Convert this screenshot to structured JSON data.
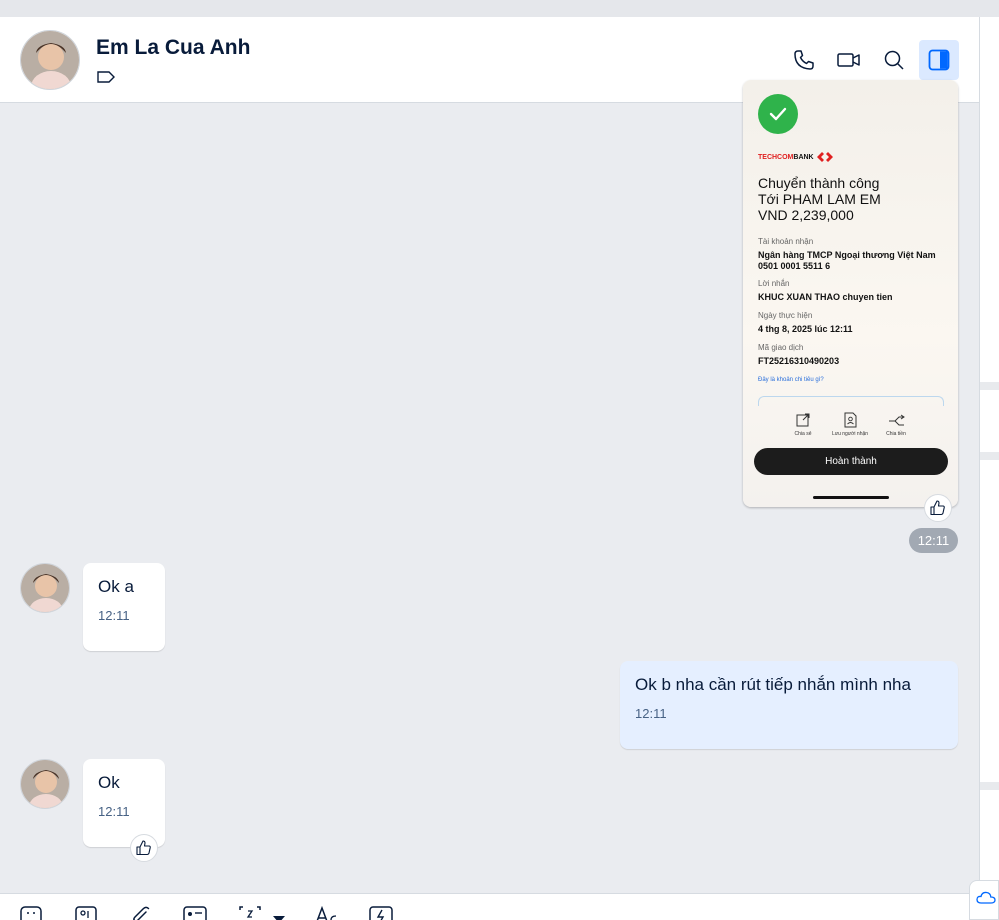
{
  "header": {
    "contact_name": "Em La Cua Anh"
  },
  "receipt": {
    "bank_brand": "TECHCOMBANK",
    "title_line1": "Chuyển thành công",
    "title_line2": "Tới PHAM LAM EM",
    "amount": "VND 2,239,000",
    "label_account": "Tài khoản nhận",
    "bank_name": "Ngân hàng TMCP Ngoại thương Việt Nam",
    "account_number": "0501 0001 5511 6",
    "label_message": "Lời nhắn",
    "message": "KHUC XUAN THAO chuyen tien",
    "label_date": "Ngày thực hiện",
    "date": "4 thg 8, 2025 lúc 12:11",
    "label_txn": "Mã giao dịch",
    "txn_id": "FT25216310490203",
    "question_link": "Đây là khoản chi tiêu gì?",
    "action_share": "Chia sẻ",
    "action_save": "Lưu người nhận",
    "action_split": "Chia tiền",
    "done_button": "Hoàn thành"
  },
  "image_time": "12:11",
  "messages": [
    {
      "text": "Ok a",
      "time": "12:11"
    },
    {
      "text": "Ok b nha cần rút tiếp nhắn mình nha",
      "time": "12:11"
    },
    {
      "text": "Ok",
      "time": "12:11"
    }
  ],
  "colors": {
    "accent": "#0068ff",
    "chat_bg": "#eaecf0",
    "my_bubble": "#e5efff",
    "success_green": "#2fb34b",
    "techcombank_red": "#e02020"
  }
}
